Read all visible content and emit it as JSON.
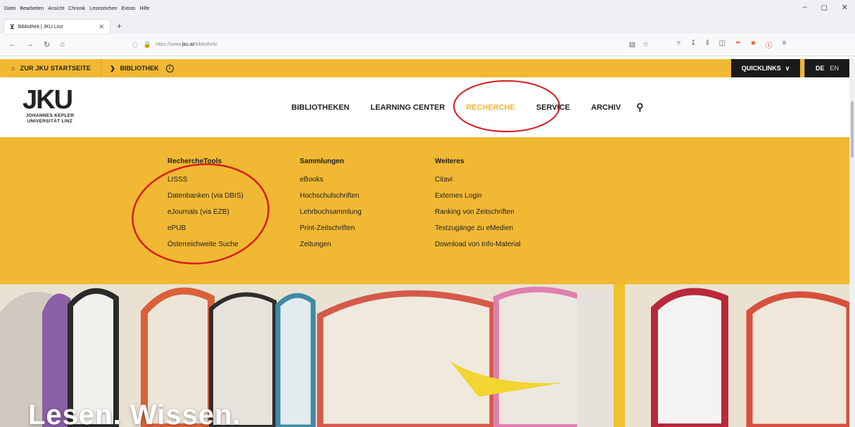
{
  "browser": {
    "menu": [
      "Datei",
      "Bearbeiten",
      "Ansicht",
      "Chronik",
      "Lesezeichen",
      "Extras",
      "Hilfe"
    ],
    "tab_title": "Bibliothek | JKU Linz",
    "url_prefix": "https://www.",
    "url_domain": "jku.at",
    "url_path": "/bibliothek/"
  },
  "site": {
    "home_label": "ZUR JKU STARTSEITE",
    "breadcrumb": "BIBLIOTHEK",
    "quicklinks": "QUICKLINKS",
    "lang_de": "DE",
    "lang_en": "EN",
    "logo_mark": "JKU",
    "logo_line1": "JOHANNES KEPLER",
    "logo_line2": "UNIVERSITÄT LINZ",
    "nav": [
      "BIBLIOTHEKEN",
      "LEARNING CENTER",
      "RECHERCHE",
      "SERVICE",
      "ARCHIV"
    ],
    "active_nav": "RECHERCHE",
    "hero_title": "Lesen. Wissen."
  },
  "megamenu": {
    "columns": [
      {
        "heading": "RechercheTools",
        "items": [
          "LISSS",
          "Datenbanken (via DBIS)",
          "eJournals (via EZB)",
          "ePUB",
          "Österreichweite Suche"
        ]
      },
      {
        "heading": "Sammlungen",
        "items": [
          "eBooks",
          "Hochschulschriften",
          "Lehrbuchsammlung",
          "Print-Zeitschriften",
          "Zeitungen"
        ]
      },
      {
        "heading": "Weiteres",
        "items": [
          "Citavi",
          "Externes Login",
          "Ranking von Zeitschriften",
          "Testzugänge zu eMedien",
          "Download von Info-Material"
        ]
      }
    ]
  },
  "colors": {
    "accent": "#f0b833",
    "annotation": "#d81b1b",
    "dark": "#1a1a1a"
  }
}
